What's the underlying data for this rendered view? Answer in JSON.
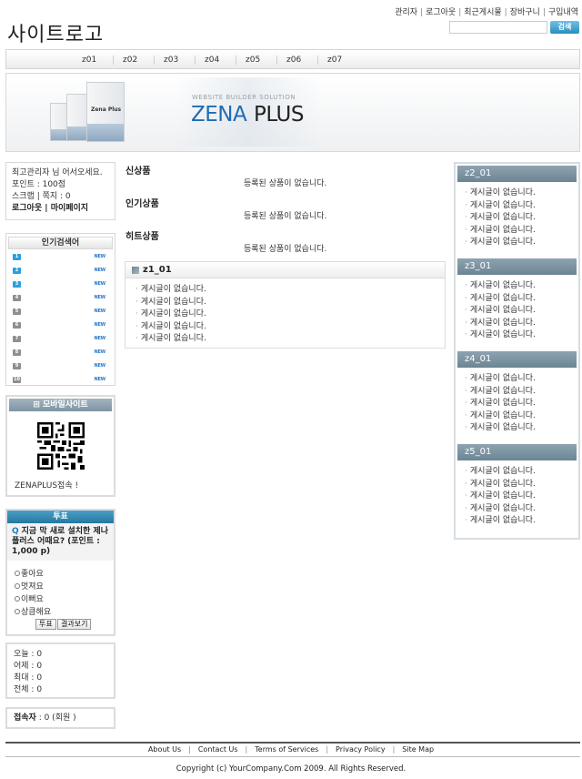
{
  "header": {
    "logo": "사이트로고",
    "top_links": [
      "관리자",
      "로그아웃",
      "최근게시물",
      "장바구니",
      "구입내역"
    ],
    "search_button": "검색"
  },
  "nav": [
    "z01",
    "z02",
    "z03",
    "z04",
    "z05",
    "z06",
    "z07"
  ],
  "banner": {
    "tagline": "WEBSITE BUILDER SOLUTION",
    "brand_primary": "ZENA",
    "brand_secondary": "PLUS",
    "box_title": "Zena Plus"
  },
  "login": {
    "greeting": "최고관리자 님 어서오세요.",
    "points": "포인트 : 100점",
    "scrap": "스크랩 | 쪽지 : 0",
    "logout": "로그아웃",
    "mypage": "마이페이지"
  },
  "popular": {
    "title": "인기검색어",
    "ranks": [
      "1",
      "2",
      "3",
      "4",
      "5",
      "6",
      "7",
      "8",
      "9",
      "10"
    ],
    "badge": "NEW"
  },
  "mobile": {
    "title": "모바일사이트",
    "text": "ZENAPLUS접속 !"
  },
  "poll": {
    "title": "투표",
    "question": "지금 막 새로 설치한 제나플러스 어때요? (포인트 : 1,000 p)",
    "options": [
      "좋아요",
      "멋져요",
      "이뻐요",
      "상큼해요"
    ],
    "vote_button": "투표",
    "result_button": "결과보기"
  },
  "counter": {
    "today": "오늘 : 0",
    "yesterday": "어제 : 0",
    "max": "최대 : 0",
    "total": "전체 : 0"
  },
  "visitors": {
    "label": "접속자",
    "value": " : 0 (회원 )"
  },
  "products": [
    {
      "title": "신상품",
      "empty": "등록된 상품이 없습니다."
    },
    {
      "title": "인기상품",
      "empty": "등록된 상품이 없습니다."
    },
    {
      "title": "히트상품",
      "empty": "등록된 상품이 없습니다."
    }
  ],
  "main_board": {
    "title": "z1_01",
    "items": [
      "게시글이 없습니다.",
      "게시글이 없습니다.",
      "게시글이 없습니다.",
      "게시글이 없습니다.",
      "게시글이 없습니다."
    ]
  },
  "right_boards": [
    {
      "title": "z2_01",
      "items": [
        "게시글이 없습니다.",
        "게시글이 없습니다.",
        "게시글이 없습니다.",
        "게시글이 없습니다.",
        "게시글이 없습니다."
      ]
    },
    {
      "title": "z3_01",
      "items": [
        "게시글이 없습니다.",
        "게시글이 없습니다.",
        "게시글이 없습니다.",
        "게시글이 없습니다.",
        "게시글이 없습니다."
      ]
    },
    {
      "title": "z4_01",
      "items": [
        "게시글이 없습니다.",
        "게시글이 없습니다.",
        "게시글이 없습니다.",
        "게시글이 없습니다.",
        "게시글이 없습니다."
      ]
    },
    {
      "title": "z5_01",
      "items": [
        "게시글이 없습니다.",
        "게시글이 없습니다.",
        "게시글이 없습니다.",
        "게시글이 없습니다.",
        "게시글이 없습니다."
      ]
    }
  ],
  "footer": {
    "links": [
      "About Us",
      "Contact Us",
      "Terms of Services",
      "Privacy Policy",
      "Site Map"
    ],
    "copyright": "Copyright (c) YourCompany.Com 2009. All Rights Reserved."
  }
}
